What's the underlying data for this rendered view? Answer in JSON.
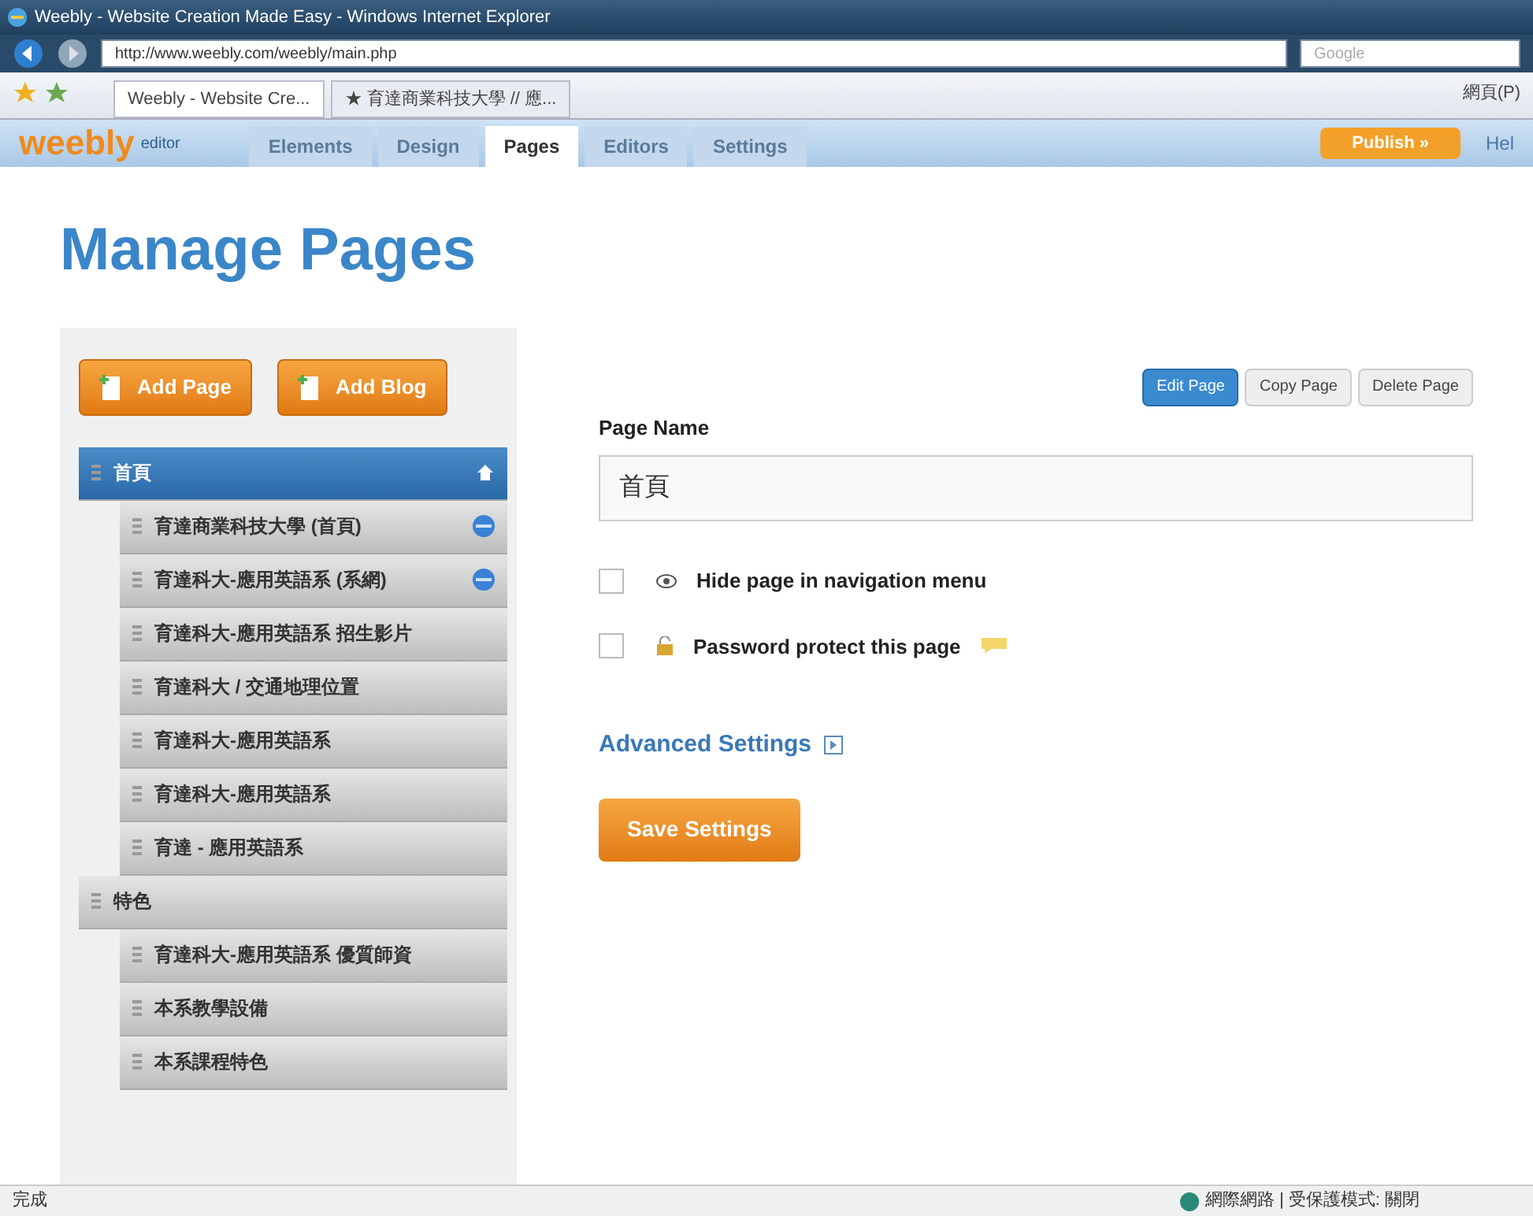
{
  "window": {
    "title": "Weebly - Website Creation Made Easy - Windows Internet Explorer"
  },
  "address_bar": {
    "url": "http://www.weebly.com/weebly/main.php",
    "search_placeholder": "Google"
  },
  "browser_tabs": [
    {
      "label": "Weebly - Website Cre...",
      "selected": true
    },
    {
      "label": "★ 育達商業科技大學 // 應...",
      "selected": false
    }
  ],
  "browser_toolbar": {
    "page_menu": "網頁(P)"
  },
  "app_nav": {
    "logo": "weebly",
    "logo_sub": "editor",
    "tabs": [
      {
        "label": "Elements",
        "selected": false
      },
      {
        "label": "Design",
        "selected": false
      },
      {
        "label": "Pages",
        "selected": true
      },
      {
        "label": "Editors",
        "selected": false
      },
      {
        "label": "Settings",
        "selected": false
      }
    ],
    "publish": "Publish »",
    "help": "Hel"
  },
  "heading": "Manage Pages",
  "sidebar": {
    "buttons": [
      "Add Page",
      "Add Blog"
    ],
    "pages": [
      {
        "name": "首頁",
        "selected": true,
        "home": true,
        "children": [
          {
            "name": "育達商業科技大學 (首頁)",
            "selected": false,
            "link": true
          },
          {
            "name": "育達科大-應用英語系 (系網)",
            "selected": false,
            "link": true
          },
          {
            "name": "育達科大-應用英語系 招生影片",
            "selected": false,
            "link": false
          },
          {
            "name": "育達科大 / 交通地理位置",
            "selected": false,
            "link": false
          },
          {
            "name": "育達科大-應用英語系",
            "selected": false,
            "link": false
          },
          {
            "name": "育達科大-應用英語系",
            "selected": false,
            "link": false
          },
          {
            "name": "育達 - 應用英語系",
            "selected": false,
            "link": false
          }
        ]
      },
      {
        "name": "特色",
        "selected": false,
        "home": false,
        "children": [
          {
            "name": "育達科大-應用英語系 優質師資",
            "selected": false,
            "link": false
          },
          {
            "name": "本系教學設備",
            "selected": false,
            "link": false
          },
          {
            "name": "本系課程特色",
            "selected": false,
            "link": false
          }
        ]
      }
    ]
  },
  "page_actions": [
    {
      "label": "Edit Page",
      "selected": true
    },
    {
      "label": "Copy Page",
      "selected": false
    },
    {
      "label": "Delete Page",
      "selected": false
    }
  ],
  "form": {
    "page_name_label": "Page Name",
    "page_name": "首頁",
    "options": [
      {
        "label": "Hide page in navigation menu",
        "checked": false,
        "kind": "hide"
      },
      {
        "label": "Password protect this page",
        "checked": false,
        "kind": "password"
      }
    ],
    "advanced": "Advanced Settings",
    "save": "Save Settings"
  },
  "status_bar": {
    "left": "完成",
    "right": "網際網路 | 受保護模式: 關閉"
  }
}
